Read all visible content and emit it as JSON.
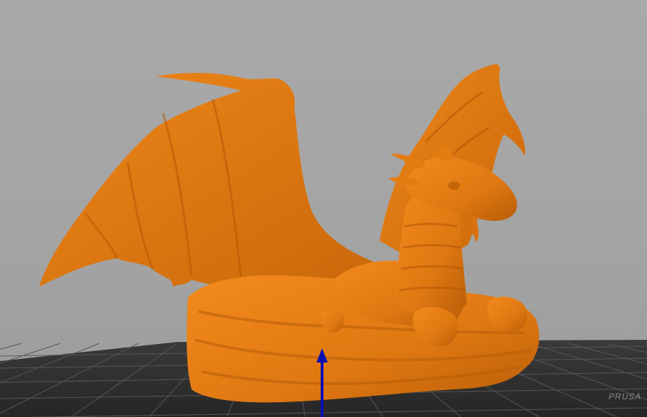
{
  "viewport": {
    "background_color": "#a7a7a7",
    "bed_color": "#2e2e2e",
    "grid_color": "#5a5a5a",
    "model_color": "#e97f13",
    "axis_color": "#0a10b0",
    "bed_label": "PRUSA"
  },
  "objects": [
    {
      "type": "3d-model",
      "label": "dragon-on-nest"
    }
  ],
  "axes": [
    {
      "axis": "z",
      "icon": "axis-arrow-icon",
      "color": "#0a10b0"
    }
  ]
}
